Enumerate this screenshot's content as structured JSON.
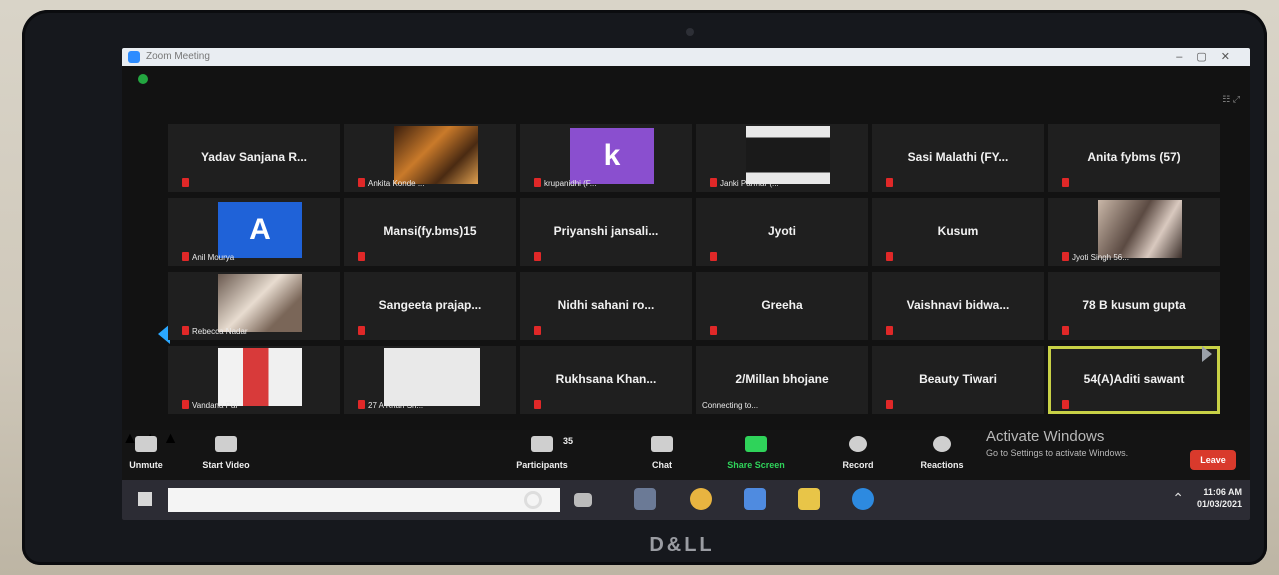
{
  "app": {
    "title": "Zoom Meeting"
  },
  "participants": [
    {
      "name": "Yadav Sanjana R..."
    },
    {
      "name": "Ankita Konde ..."
    },
    {
      "name": "krupanidhi (F..."
    },
    {
      "name": "Janki Parmar (..."
    },
    {
      "name": "Sasi Malathi (FY..."
    },
    {
      "name": "Anita fybms (57)"
    },
    {
      "name": "Anil Mourya",
      "initial": "A"
    },
    {
      "name": "Mansi(fy.bms)15"
    },
    {
      "name": "Priyanshi jansali..."
    },
    {
      "name": "Jyoti"
    },
    {
      "name": "Kusum"
    },
    {
      "name": "Jyoti Singh 56..."
    },
    {
      "name": "Rebecca Nadar"
    },
    {
      "name": "Sangeeta prajap..."
    },
    {
      "name": "Nidhi sahani ro..."
    },
    {
      "name": "Greeha"
    },
    {
      "name": "Vaishnavi bidwa..."
    },
    {
      "name": "78 B kusum gupta"
    },
    {
      "name": "Vandana Pal"
    },
    {
      "name": "27 A Khan Sh..."
    },
    {
      "name": "Rukhsana Khan..."
    },
    {
      "name": "2/Millan bhojane",
      "status": "Connecting to..."
    },
    {
      "name": "Beauty Tiwari"
    },
    {
      "name": "54(A)Aditi sawant"
    }
  ],
  "krupanidhi_initial": "k",
  "toolbar": {
    "unmute": "Unmute",
    "start_video": "Start Video",
    "participants": "Participants",
    "participants_count": "35",
    "chat": "Chat",
    "share_screen": "Share Screen",
    "record": "Record",
    "reactions": "Reactions",
    "leave": "Leave"
  },
  "watermark": {
    "title": "Activate Windows",
    "subtitle": "Go to Settings to activate Windows."
  },
  "taskbar": {
    "time": "11:06 AM",
    "date": "01/03/2021"
  },
  "brand": "D&LL",
  "colors": {
    "share": "#2fd35a",
    "leave": "#d93a2c",
    "active_border": "#c8d146",
    "muted": "#e02828"
  }
}
